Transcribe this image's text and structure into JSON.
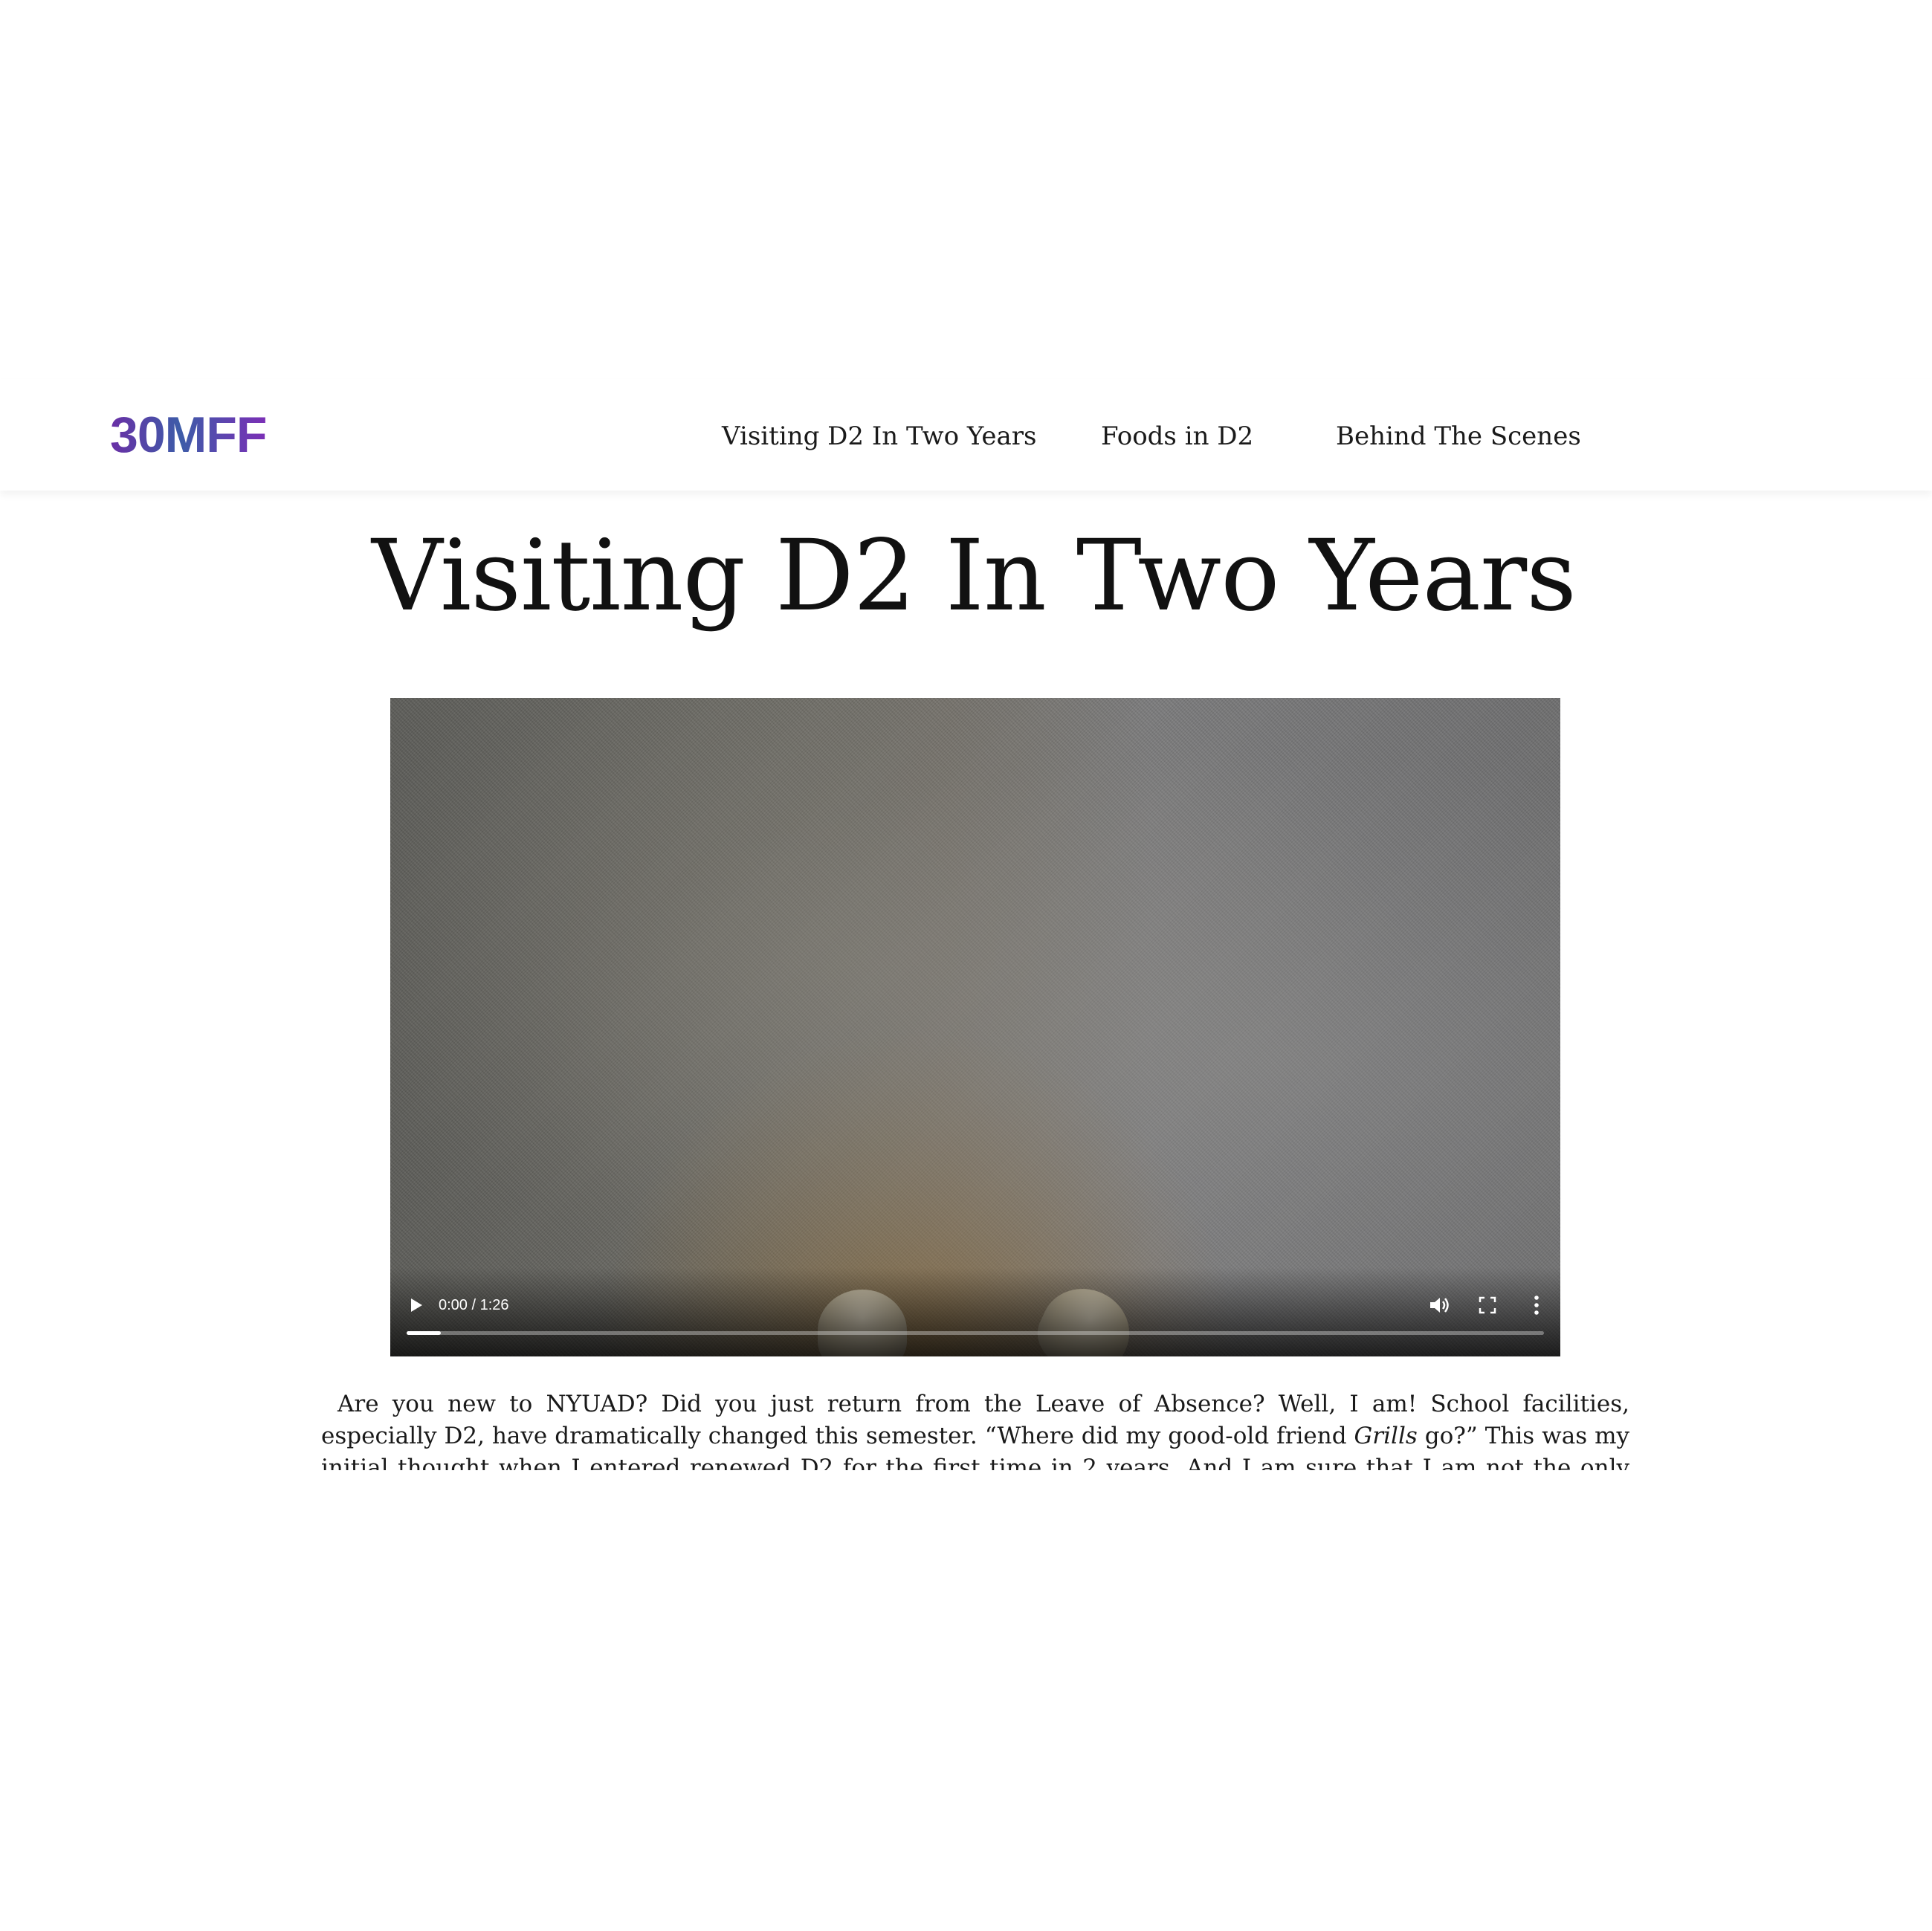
{
  "header": {
    "logo_text": "30MFF",
    "nav": [
      {
        "label": "Visiting D2 In Two Years"
      },
      {
        "label": "Foods in D2"
      },
      {
        "label": "Behind The Scenes"
      }
    ]
  },
  "main": {
    "title": "Visiting D2 In Two Years",
    "video": {
      "time_readout": "0:00 / 1:26",
      "progress_fraction": 0.03,
      "icons": [
        "play-icon",
        "volume-icon",
        "fullscreen-icon",
        "more-options-icon"
      ]
    },
    "article": {
      "part1": "Are you new to NYUAD? Did you just return from the Leave of Absence? Well, I am! School facilities, especially D2, have dramatically changed this semester. “Where did my good-old friend ",
      "italic": "Grills",
      "part2": " go?” This was my initial thought when I entered renewed D2 for the first time in 2 years. And I am sure that I am not the only one who had faced"
    }
  },
  "colors": {
    "logo_gradient_start": "#6a2fa6",
    "logo_gradient_mid": "#3d5ca8",
    "logo_gradient_end": "#7b2fb6",
    "text": "#1a1a1a",
    "background": "#ffffff"
  }
}
